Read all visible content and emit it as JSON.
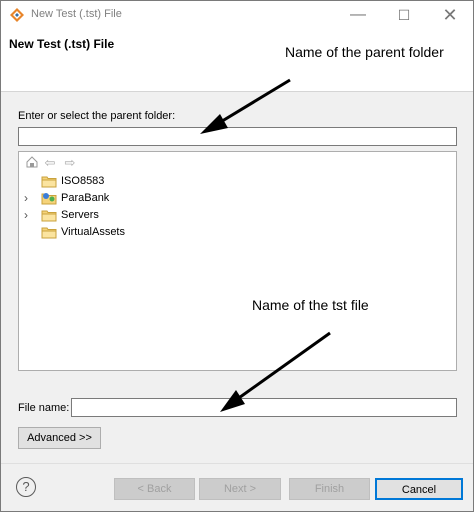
{
  "window": {
    "title": "New Test (.tst) File"
  },
  "header": {
    "title": "New Test (.tst) File"
  },
  "annotations": {
    "parent_folder": "Name of the parent folder",
    "tst_file": "Name of the tst file"
  },
  "parent_folder": {
    "label": "Enter or select the parent folder:",
    "value": ""
  },
  "tree": {
    "items": [
      {
        "label": "ISO8583",
        "expandable": false,
        "icon": "folder-icon"
      },
      {
        "label": "ParaBank",
        "expandable": true,
        "icon": "project-icon"
      },
      {
        "label": "Servers",
        "expandable": true,
        "icon": "folder-icon"
      },
      {
        "label": "VirtualAssets",
        "expandable": false,
        "icon": "folder-icon"
      }
    ]
  },
  "file_name": {
    "label": "File name:",
    "value": ""
  },
  "buttons": {
    "advanced": "Advanced >>",
    "back": "< Back",
    "next": "Next >",
    "finish": "Finish",
    "cancel": "Cancel",
    "help": "?"
  }
}
